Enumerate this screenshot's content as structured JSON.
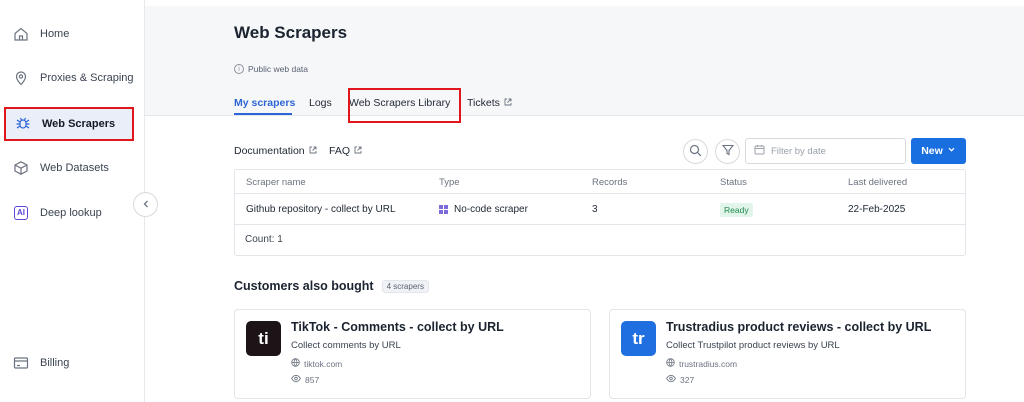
{
  "sidebar": {
    "items": [
      {
        "label": "Home",
        "icon": "home-icon"
      },
      {
        "label": "Proxies & Scraping",
        "icon": "location-pin-icon"
      },
      {
        "label": "Web Scrapers",
        "icon": "spider-icon"
      },
      {
        "label": "Web Datasets",
        "icon": "cube-icon"
      },
      {
        "label": "Deep lookup",
        "icon": "ai-badge-icon",
        "badge": "AI"
      },
      {
        "label": "Billing",
        "icon": "billing-icon"
      }
    ],
    "active": "Web Scrapers"
  },
  "header": {
    "title": "Web Scrapers",
    "subtitle": "Public web data",
    "tabs": [
      {
        "label": "My scrapers"
      },
      {
        "label": "Logs"
      },
      {
        "label": "Web Scrapers Library"
      },
      {
        "label": "Tickets"
      }
    ],
    "active_tab": "My scrapers"
  },
  "toolbar": {
    "documentation": "Documentation",
    "faq": "FAQ",
    "date_placeholder": "Filter by date",
    "new_label": "New"
  },
  "table": {
    "columns": [
      "Scraper name",
      "Type",
      "Records",
      "Status",
      "Last delivered"
    ],
    "rows": [
      {
        "name": "Github repository - collect by URL",
        "type": "No-code scraper",
        "records": "3",
        "status": "Ready",
        "last_delivered": "22-Feb-2025"
      }
    ],
    "count": "Count: 1"
  },
  "recommendations": {
    "title": "Customers also bought",
    "count_label": "4 scrapers",
    "cards": [
      {
        "logo": "ti",
        "logo_color": "#1c1416",
        "title": "TikTok - Comments - collect by URL",
        "desc": "Collect comments by URL",
        "domain": "tiktok.com",
        "views": "857"
      },
      {
        "logo": "tr",
        "logo_color": "#1f6fe0",
        "title": "Trustradius product reviews - collect by URL",
        "desc": "Collect Trustpilot product reviews by URL",
        "domain": "trustradius.com",
        "views": "327"
      }
    ]
  },
  "colors": {
    "accent": "#2d65d6",
    "primary_button": "#1a6fe0",
    "highlight": "#e0161c",
    "status_ready": "#1f8a50"
  }
}
